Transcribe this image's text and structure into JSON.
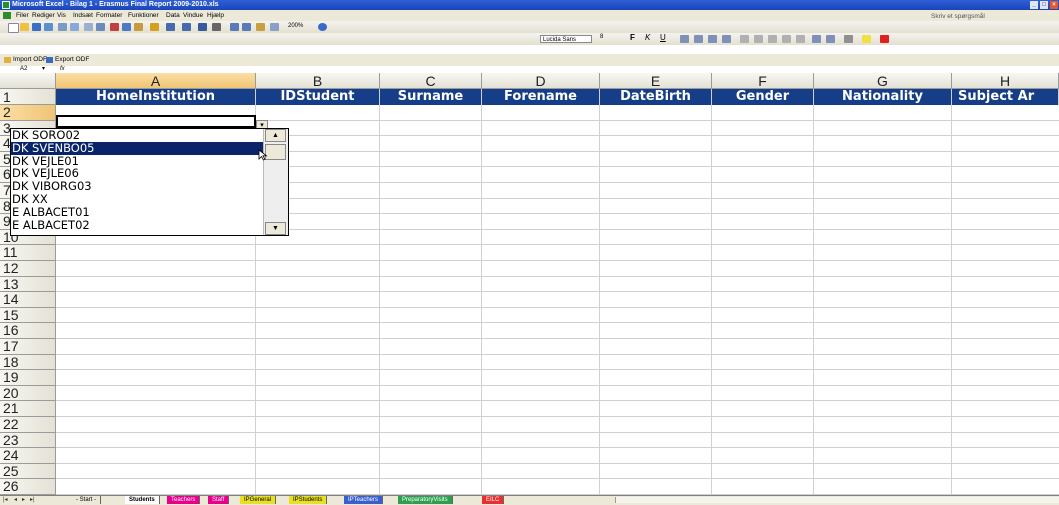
{
  "window": {
    "title": "Microsoft Excel - Bilag 1 - Erasmus Final Report 2009-2010.xls",
    "help_placeholder": "Skriv et spørgsmål"
  },
  "menu": [
    "Filer",
    "Rediger",
    "Vis",
    "Indsæt",
    "Formater",
    "Funktioner",
    "Data",
    "Vindue",
    "Hjælp"
  ],
  "toolbar": {
    "zoom": "200%",
    "font": "Lucida Sans",
    "font_size": "8"
  },
  "odf_toolbar": {
    "import_label": "Import ODF",
    "export_label": "Export ODF"
  },
  "formula_bar": {
    "name_box": "A2",
    "fx": "fx"
  },
  "grid": {
    "columns": [
      "A",
      "B",
      "C",
      "D",
      "E",
      "F",
      "G",
      "H"
    ],
    "header_row": [
      "HomeInstitution",
      "IDStudent",
      "Surname",
      "Forename",
      "DateBirth",
      "Gender",
      "Nationality",
      "Subject Ar"
    ],
    "rows": [
      "1",
      "2",
      "3",
      "4",
      "5",
      "6",
      "7",
      "8",
      "9",
      "10",
      "11",
      "12",
      "13",
      "14",
      "15",
      "16",
      "17",
      "18",
      "19",
      "20",
      "21",
      "22",
      "23",
      "24",
      "25",
      "26"
    ],
    "selected_cell": "A2"
  },
  "dropdown": {
    "items": [
      "DK SORO02",
      "DK SVENBO05",
      "DK VEJLE01",
      "DK VEJLE06",
      "DK VIBORG03",
      "DK XX",
      "E  ALBACET01",
      "E  ALBACET02"
    ],
    "highlighted": "DK SVENBO05"
  },
  "sheet_tabs": [
    {
      "label": "- Start -",
      "color": "#ece9d8"
    },
    {
      "label": "Students",
      "color": "#ffffff"
    },
    {
      "label": "Teachers",
      "color": "#e8008a"
    },
    {
      "label": "Staff",
      "color": "#e8008a"
    },
    {
      "label": "IPGeneral",
      "color": "#e8e020"
    },
    {
      "label": "IPStudents",
      "color": "#e8e020"
    },
    {
      "label": "IPTeachers",
      "color": "#3a5fcd"
    },
    {
      "label": "PreparatoryVisits",
      "color": "#2e9e4f"
    },
    {
      "label": "EILC",
      "color": "#e83030"
    }
  ]
}
